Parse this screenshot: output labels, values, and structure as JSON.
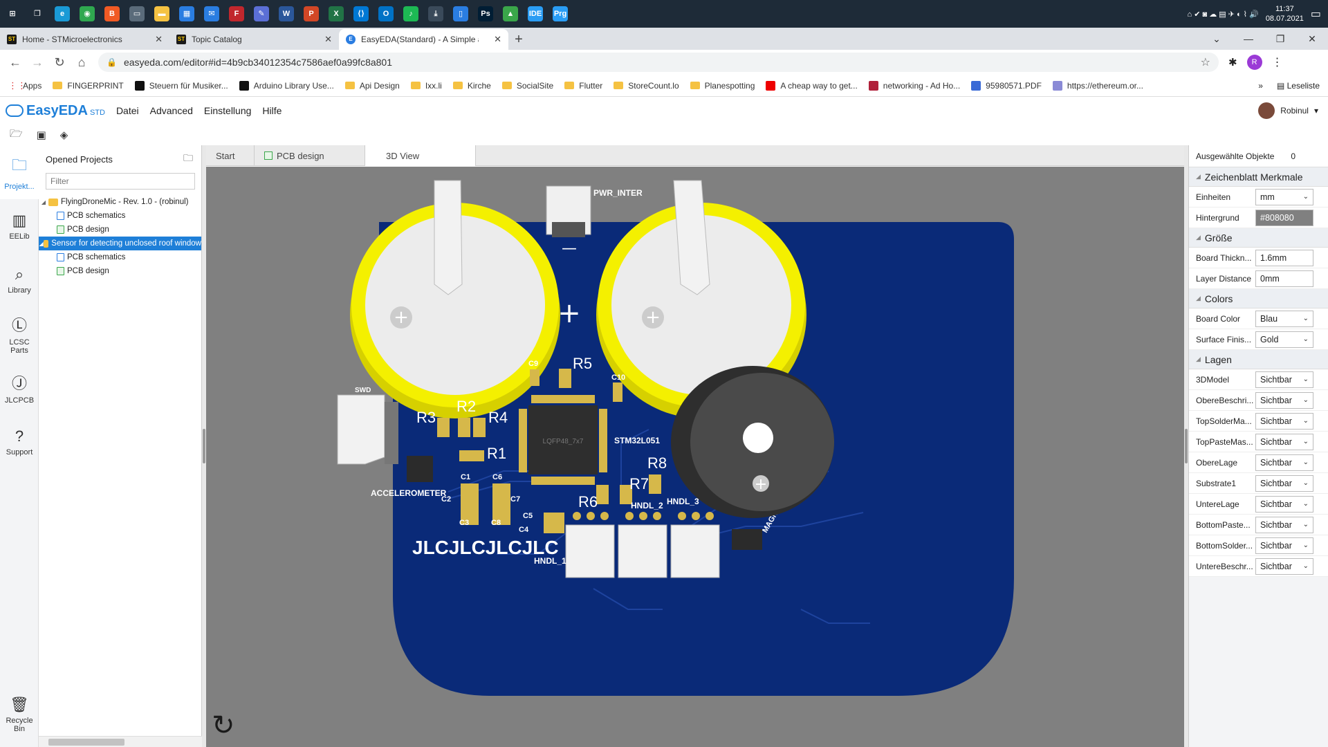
{
  "taskbar": {
    "apps": [
      {
        "name": "windows-start-icon",
        "glyph": "⊞",
        "bg": "transparent"
      },
      {
        "name": "task-view-icon",
        "glyph": "❐",
        "bg": "transparent"
      },
      {
        "name": "edge-icon",
        "glyph": "e",
        "bg": "#1a9ad6"
      },
      {
        "name": "chrome-icon",
        "glyph": "◉",
        "bg": "#2fa84f"
      },
      {
        "name": "brave-icon",
        "glyph": "B",
        "bg": "#f15a24"
      },
      {
        "name": "screen-icon",
        "glyph": "▭",
        "bg": "#5a6b7a"
      },
      {
        "name": "explorer-icon",
        "glyph": "▬",
        "bg": "#f5c242"
      },
      {
        "name": "store-icon",
        "glyph": "▦",
        "bg": "#2a7de1"
      },
      {
        "name": "mail-icon",
        "glyph": "✉",
        "bg": "#2a7de1"
      },
      {
        "name": "filezilla-icon",
        "glyph": "F",
        "bg": "#c1272d"
      },
      {
        "name": "app-icon",
        "glyph": "✎",
        "bg": "#5b6fd6"
      },
      {
        "name": "word-icon",
        "glyph": "W",
        "bg": "#2b579a"
      },
      {
        "name": "powerpoint-icon",
        "glyph": "P",
        "bg": "#d24726"
      },
      {
        "name": "excel-icon",
        "glyph": "X",
        "bg": "#217346"
      },
      {
        "name": "vscode-icon",
        "glyph": "⟨⟩",
        "bg": "#0078d4"
      },
      {
        "name": "outlook-icon",
        "glyph": "O",
        "bg": "#0072c6"
      },
      {
        "name": "spotify-icon",
        "glyph": "♪",
        "bg": "#1db954"
      },
      {
        "name": "download-icon",
        "glyph": "⤓",
        "bg": "#3a4a5a"
      },
      {
        "name": "phone-icon",
        "glyph": "▯",
        "bg": "#2a7de1"
      },
      {
        "name": "photoshop-icon",
        "glyph": "Ps",
        "bg": "#001d34"
      },
      {
        "name": "photos-icon",
        "glyph": "▲",
        "bg": "#3aa64a"
      },
      {
        "name": "ide-icon",
        "glyph": "IDE",
        "bg": "#2a9df4"
      },
      {
        "name": "prg-icon",
        "glyph": "Prg",
        "bg": "#2a9df4"
      }
    ],
    "time": "11:37",
    "date": "08.07.2021"
  },
  "browser": {
    "tabs": [
      {
        "title": "Home - STMicroelectronics",
        "icon": "ST"
      },
      {
        "title": "Topic Catalog",
        "icon": "ST"
      },
      {
        "title": "EasyEDA(Standard) - A Simple and Powerful",
        "icon": "E"
      }
    ],
    "url": "easyeda.com/editor#id=4b9cb34012354c7586aef0a99fc8a801",
    "profile_initial": "R",
    "bookmarks": [
      {
        "label": "Apps",
        "kind": "apps"
      },
      {
        "label": "FINGERPRINT",
        "kind": "folder"
      },
      {
        "label": "Steuern für Musiker...",
        "kind": "site",
        "color": "#111"
      },
      {
        "label": "Arduino Library Use...",
        "kind": "site",
        "color": "#111"
      },
      {
        "label": "Api Design",
        "kind": "folder"
      },
      {
        "label": "Ixx.li",
        "kind": "folder"
      },
      {
        "label": "Kirche",
        "kind": "folder"
      },
      {
        "label": "SocialSite",
        "kind": "folder"
      },
      {
        "label": "Flutter",
        "kind": "folder"
      },
      {
        "label": "StoreCount.lo",
        "kind": "folder"
      },
      {
        "label": "Planespotting",
        "kind": "folder"
      },
      {
        "label": "A cheap way to get...",
        "kind": "site",
        "color": "#e00"
      },
      {
        "label": "networking - Ad Ho...",
        "kind": "site",
        "color": "#b0203a"
      },
      {
        "label": "95980571.PDF",
        "kind": "site",
        "color": "#3a6ad6"
      },
      {
        "label": "https://ethereum.or...",
        "kind": "site",
        "color": "#8a8ad6"
      }
    ],
    "reading_list": "Leseliste"
  },
  "app": {
    "logo": "EasyEDA",
    "logo_suffix": "STD",
    "menu": [
      "Datei",
      "Advanced",
      "Einstellung",
      "Hilfe"
    ],
    "user": "Robinul"
  },
  "leftnav": [
    {
      "label": "Projekt...",
      "icon": "folder-icon",
      "glyph": "🗀"
    },
    {
      "label": "EELib",
      "icon": "chip-icon",
      "glyph": "▥"
    },
    {
      "label": "Library",
      "icon": "search-icon",
      "glyph": "⌕"
    },
    {
      "label": "LCSC Parts",
      "icon": "lcsc-icon",
      "glyph": "Ⓛ"
    },
    {
      "label": "JLCPCB",
      "icon": "jlc-icon",
      "glyph": "Ⓙ"
    },
    {
      "label": "Support",
      "icon": "help-icon",
      "glyph": "?"
    }
  ],
  "recycle": "Recycle Bin",
  "projects": {
    "title": "Opened Projects",
    "filter_placeholder": "Filter",
    "tree": [
      {
        "level": 0,
        "label": "FlyingDroneMic - Rev. 1.0 - (robinul)",
        "type": "folder",
        "selected": false
      },
      {
        "level": 1,
        "label": "PCB schematics",
        "type": "sch",
        "selected": false
      },
      {
        "level": 1,
        "label": "PCB design",
        "type": "pcb",
        "selected": false
      },
      {
        "level": 0,
        "label": "Sensor for detecting unclosed roof window",
        "type": "folder",
        "selected": true
      },
      {
        "level": 1,
        "label": "PCB schematics",
        "type": "sch",
        "selected": false
      },
      {
        "level": 1,
        "label": "PCB design",
        "type": "pcb",
        "selected": false
      }
    ]
  },
  "doctabs": [
    {
      "label": "Start",
      "active": false
    },
    {
      "label": "PCB design",
      "active": false
    },
    {
      "label": "3D View",
      "active": true
    }
  ],
  "board": {
    "silk": {
      "pwr": "PWR_INTER",
      "swd": "SWD",
      "accel": "ACCELEROMETER",
      "mcu": "STM32L051",
      "mcu_pkg": "LQFP48_7x7",
      "jlc": "JLCJLCJLCJLC",
      "magn": "MAGN",
      "hndl1": "HNDL_1",
      "hndl2": "HNDL_2",
      "hndl3": "HNDL_3",
      "r1": "R1",
      "r2": "R2",
      "r3": "R3",
      "r4": "R4",
      "r5": "R5",
      "r6": "R6",
      "r7": "R7",
      "r8": "R8",
      "c1": "C1",
      "c2": "C2",
      "c3": "C3",
      "c4": "C4",
      "c5": "C5",
      "c6": "C6",
      "c7": "C7",
      "c8": "C8",
      "c9": "C9",
      "c10": "C10",
      "minus": "—",
      "plus": "+"
    },
    "colors": {
      "board": "#0a2a78",
      "battery": "#f4f000",
      "background": "#808080"
    }
  },
  "properties": {
    "selected_label": "Ausgewählte Objekte",
    "selected_count": "0",
    "sections": [
      {
        "title": "Zeichenblatt Merkmale",
        "rows": [
          {
            "label": "Einheiten",
            "value": "mm",
            "dropdown": true
          },
          {
            "label": "Hintergrund",
            "value": "#808080",
            "dropdown": false,
            "color": true
          }
        ]
      },
      {
        "title": "Größe",
        "rows": [
          {
            "label": "Board Thickn...",
            "value": "1.6mm",
            "dropdown": false
          },
          {
            "label": "Layer Distance",
            "value": "0mm",
            "dropdown": false
          }
        ]
      },
      {
        "title": "Colors",
        "rows": [
          {
            "label": "Board Color",
            "value": "Blau",
            "dropdown": true
          },
          {
            "label": "Surface Finis...",
            "value": "Gold",
            "dropdown": true
          }
        ]
      },
      {
        "title": "Lagen",
        "rows": [
          {
            "label": "3DModel",
            "value": "Sichtbar",
            "dropdown": true
          },
          {
            "label": "ObereBeschri...",
            "value": "Sichtbar",
            "dropdown": true
          },
          {
            "label": "TopSolderMa...",
            "value": "Sichtbar",
            "dropdown": true
          },
          {
            "label": "TopPasteMas...",
            "value": "Sichtbar",
            "dropdown": true
          },
          {
            "label": "ObereLage",
            "value": "Sichtbar",
            "dropdown": true
          },
          {
            "label": "Substrate1",
            "value": "Sichtbar",
            "dropdown": true
          },
          {
            "label": "UntereLage",
            "value": "Sichtbar",
            "dropdown": true
          },
          {
            "label": "BottomPaste...",
            "value": "Sichtbar",
            "dropdown": true
          },
          {
            "label": "BottomSolder...",
            "value": "Sichtbar",
            "dropdown": true
          },
          {
            "label": "UntereBeschr...",
            "value": "Sichtbar",
            "dropdown": true
          }
        ]
      }
    ]
  }
}
